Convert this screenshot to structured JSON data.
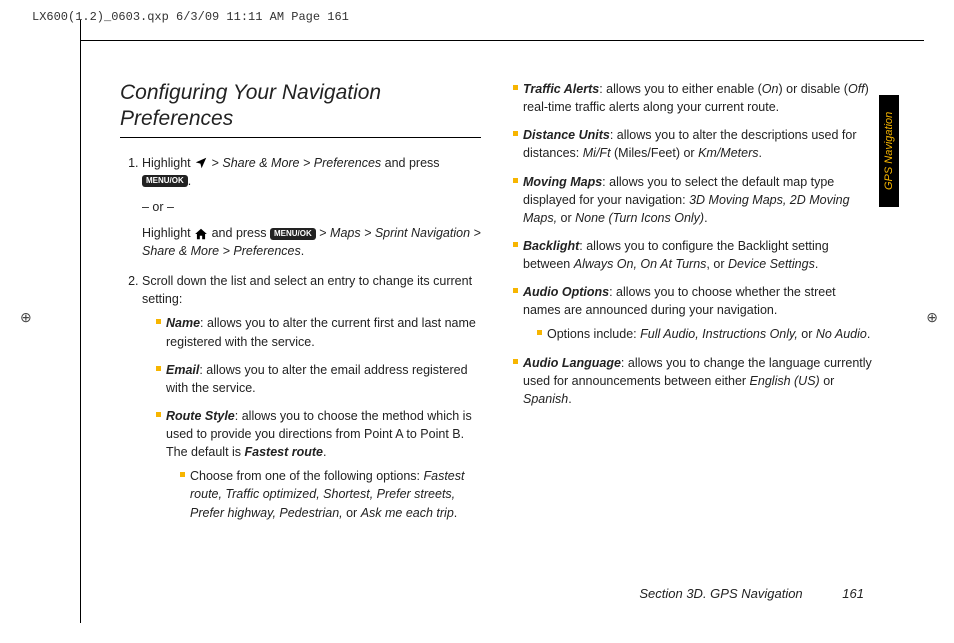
{
  "header": "LX600(1.2)_0603.qxp  6/3/09  11:11 AM  Page 161",
  "side_tab": "GPS Navigation",
  "footer": {
    "section": "Section 3D. GPS Navigation",
    "page": "161"
  },
  "crop_o_left": "⊕",
  "crop_o_right": "⊕",
  "title_line1": "Configuring Your Navigation",
  "title_line2": "Preferences",
  "s1_a": "Highlight ",
  "s1_b": "Share & More > Preferences",
  "s1_c": " and press ",
  "s1_dot": ".",
  "s1_or": "– or –",
  "s1_d": "Highlight ",
  "s1_e": " and press ",
  "s1_f": "Maps > Sprint Navigation > Share & More > Preferences",
  "s1_g": ".",
  "s2_intro": "Scroll down the list and select an entry to change its current setting:",
  "b_name_t": "Name",
  "b_name": ": allows you to alter the current first and last name registered with the service.",
  "b_email_t": "Email",
  "b_email": ": allows you to alter the email address registered with the service.",
  "b_route_t": "Route Style",
  "b_route": ": allows you to choose the method which is used to provide you directions from Point A to Point B. The default is ",
  "b_route_def": "Fastest route",
  "b_route_dot": ".",
  "b_route_sub_a": "Choose from one of the following options: ",
  "b_route_sub_b": "Fastest route, Traffic optimized, Shortest, Prefer streets, Prefer highway, Pedestrian,",
  "b_route_sub_c": " or ",
  "b_route_sub_d": "Ask me each trip",
  "b_route_sub_e": ".",
  "r_traffic_t": "Traffic Alerts",
  "r_traffic_a": ": allows you to either enable (",
  "r_traffic_on": "On",
  "r_traffic_b": ") or disable (",
  "r_traffic_off": "Off",
  "r_traffic_c": ") real-time traffic alerts along your current route.",
  "r_dist_t": "Distance Units",
  "r_dist_a": ": allows you to alter the descriptions used for distances: ",
  "r_dist_b": "Mi/Ft",
  "r_dist_c": " (Miles/Feet) or ",
  "r_dist_d": "Km/Meters",
  "r_dist_e": ".",
  "r_map_t": "Moving Maps",
  "r_map_a": ": allows you to select the default map type displayed for your navigation: ",
  "r_map_b": "3D Moving Maps, 2D Moving Maps,",
  "r_map_c": " or ",
  "r_map_d": "None (Turn Icons Only)",
  "r_map_e": ".",
  "r_back_t": "Backlight",
  "r_back_a": ": allows you to configure the Backlight setting between ",
  "r_back_b": "Always On, On At Turns",
  "r_back_c": ", or ",
  "r_back_d": "Device Settings",
  "r_back_e": ".",
  "r_audio_t": "Audio Options",
  "r_audio_a": ": allows you to choose whether the street names are announced during your navigation.",
  "r_audio_sub_a": "Options include: ",
  "r_audio_sub_b": "Full Audio, Instructions Only,",
  "r_audio_sub_c": " or ",
  "r_audio_sub_d": "No Audio",
  "r_audio_sub_e": ".",
  "r_lang_t": "Audio Language",
  "r_lang_a": ": allows you to change the language currently used for announcements between either ",
  "r_lang_b": "English (US)",
  "r_lang_c": " or ",
  "r_lang_d": "Spanish",
  "r_lang_e": ".",
  "key_menu_ok": "MENU/OK",
  "gt": " > "
}
